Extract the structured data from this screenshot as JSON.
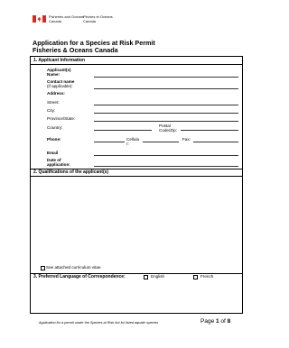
{
  "header": {
    "dept_en_line1": "Fisheries and Oceans",
    "dept_en_line2": "Canada",
    "dept_fr_line1": "Pêches et Océans",
    "dept_fr_line2": "Canada",
    "title_line1": "Application for a Species at Risk Permit",
    "title_line2": "Fisheries & Oceans Canada",
    "flag_color": "#d52b1e"
  },
  "section1": {
    "title": "1.  Applicant Information",
    "applicant_name_label_1": "Applicant(s)",
    "applicant_name_label_2": "Name:",
    "contact_label_1": "Contact name",
    "contact_label_2": "(if applicable):",
    "address_label": "Address:",
    "street_label": "Street:",
    "city_label": "City:",
    "province_label": "Province/State:",
    "country_label": "Country:",
    "postal_label_1": "Postal",
    "postal_label_2": "Code/Zip:",
    "phone_label": "Phone:",
    "cellular_label_1": "Cellula",
    "cellular_label_2": "r:",
    "fax_label": "Fax:",
    "email_label": "Email",
    "dob_label_1": "Date of",
    "dob_label_2": "application:"
  },
  "section2": {
    "title": "2.  Qualifications of the applicant(s)",
    "cv_label": "See attached curriculum vitae"
  },
  "section3": {
    "title": "3.  Preferred Language of Correspondence:",
    "english": "English",
    "french": "French"
  },
  "footer": {
    "text": "Application for a permit under the Species at Risk Act for listed aquatic species",
    "page_prefix": "Page ",
    "page_num": "1",
    "page_mid": " of ",
    "page_total": "8"
  }
}
